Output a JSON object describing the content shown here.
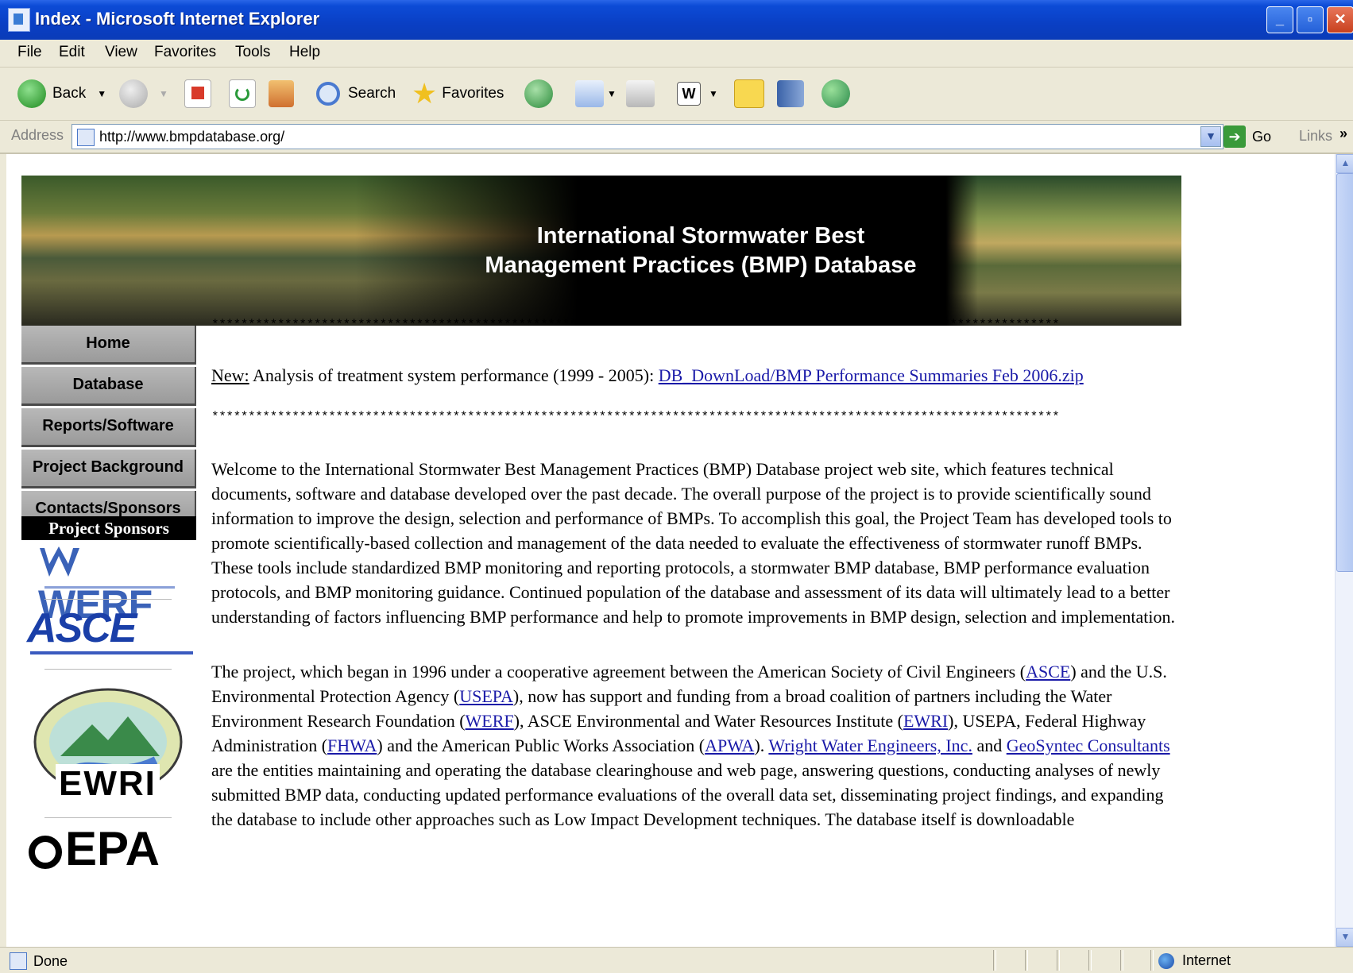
{
  "window": {
    "title": "Index - Microsoft Internet Explorer",
    "controls": [
      "_",
      "▫",
      "✕"
    ]
  },
  "menu": [
    "File",
    "Edit",
    "View",
    "Favorites",
    "Tools",
    "Help"
  ],
  "toolbar": {
    "back_label": "Back",
    "search_label": "Search",
    "favorites_label": "Favorites"
  },
  "address": {
    "label": "Address",
    "url": "http://www.bmpdatabase.org/",
    "go_label": "Go",
    "links_label": "Links"
  },
  "banner": {
    "title_line1": "International Stormwater Best",
    "title_line2": "Management Practices (BMP) Database"
  },
  "nav": [
    {
      "label": "Home"
    },
    {
      "label": "Database"
    },
    {
      "label": "Reports/Software"
    },
    {
      "label": "Project Background"
    },
    {
      "label": "Contacts/Sponsors"
    }
  ],
  "sponsors": {
    "heading": "Project Sponsors",
    "werf": "WERF",
    "asce": "ASCE",
    "ewri": "EWRI",
    "epa": "EPA"
  },
  "content": {
    "stars": "********************************************************************************************************************",
    "new_label": "New:",
    "new_text": " Analysis of treatment system performance (1999 - 2005): ",
    "new_link": "DB_DownLoad/BMP Performance Summaries Feb 2006.zip",
    "welcome": "Welcome to the International Stormwater Best Management Practices (BMP) Database project web site, which features technical documents, software and database developed over the past decade. The overall purpose of the project is to provide scientifically sound information to improve the design, selection and performance of BMPs. To accomplish this goal, the Project Team has developed tools to promote scientifically-based collection and management of the data needed to evaluate the effectiveness of stormwater runoff BMPs. These tools include standardized BMP monitoring and reporting protocols, a stormwater BMP database, BMP performance evaluation protocols, and BMP monitoring guidance. Continued population of the database and assessment of its data will ultimately lead to a better understanding of factors influencing BMP performance and help to promote improvements in BMP design, selection and implementation.",
    "p2_a": "The project, which began in 1996 under a cooperative agreement between the American Society of Civil Engineers (",
    "link_asce": "ASCE",
    "p2_b": ") and the U.S. Environmental Protection Agency (",
    "link_usepa": "USEPA",
    "p2_c": "), now has support and funding from a broad coalition of partners including the Water Environment Research Foundation (",
    "link_werf": "WERF",
    "p2_d": "), ASCE Environmental and Water Resources Institute (",
    "link_ewri": "EWRI",
    "p2_e": "), USEPA, Federal Highway Administration (",
    "link_fhwa": "FHWA",
    "p2_f": ") and the American Public Works Association (",
    "link_apwa": "APWA",
    "p2_g": "). ",
    "link_wright": "Wright Water Engineers, Inc.",
    "p2_h": " and ",
    "link_geosyntec": "GeoSyntec Consultants",
    "p2_i": " are the entities maintaining and operating the database clearinghouse and web page, answering questions, conducting analyses of newly submitted BMP data, conducting updated performance evaluations of the overall data set, disseminating project findings, and expanding the database to include other approaches such as Low Impact Development techniques. The database itself is downloadable"
  },
  "status": {
    "text": "Done",
    "zone": "Internet"
  }
}
